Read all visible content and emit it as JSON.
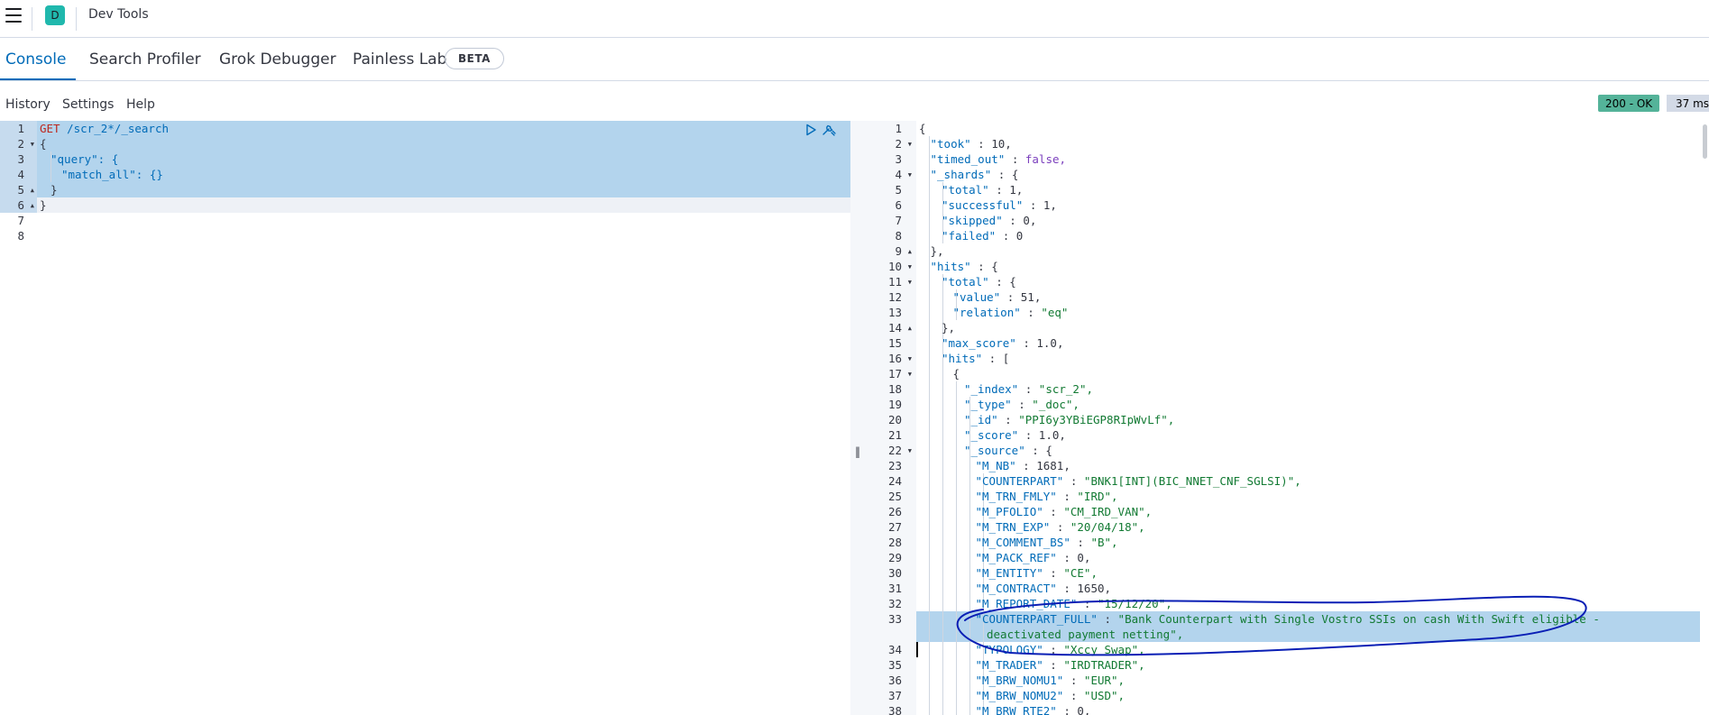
{
  "header": {
    "space_initial": "D",
    "app_title": "Dev Tools"
  },
  "tabs": [
    {
      "label": "Console",
      "active": true
    },
    {
      "label": "Search Profiler",
      "active": false
    },
    {
      "label": "Grok Debugger",
      "active": false
    },
    {
      "label": "Painless Lab",
      "active": false
    }
  ],
  "beta_badge": "BETA",
  "toolbar": {
    "history": "History",
    "settings": "Settings",
    "help": "Help"
  },
  "status": {
    "code": "200 - OK",
    "time": "37 ms",
    "ok_color": "#54b399"
  },
  "request": {
    "line_numbers": [
      "1",
      "2",
      "3",
      "4",
      "5",
      "6",
      "7",
      "8"
    ],
    "method": "GET",
    "path": "/scr_2*/_search",
    "lines": [
      "{",
      "\"query\": {",
      "\"match_all\": {}",
      "}",
      "}",
      "",
      ""
    ]
  },
  "response": {
    "line_numbers": [
      "1",
      "2",
      "3",
      "4",
      "5",
      "6",
      "7",
      "8",
      "9",
      "10",
      "11",
      "12",
      "13",
      "14",
      "15",
      "16",
      "17",
      "18",
      "19",
      "20",
      "21",
      "22",
      "23",
      "24",
      "25",
      "26",
      "27",
      "28",
      "29",
      "30",
      "31",
      "32",
      "33",
      "",
      "34",
      "35",
      "36",
      "37",
      "38"
    ],
    "lines": [
      "{",
      "\"took\" : 10,",
      "\"timed_out\" : false,",
      "\"_shards\" : {",
      "\"total\" : 1,",
      "\"successful\" : 1,",
      "\"skipped\" : 0,",
      "\"failed\" : 0",
      "},",
      "\"hits\" : {",
      "\"total\" : {",
      "\"value\" : 51,",
      "\"relation\" : \"eq\"",
      "},",
      "\"max_score\" : 1.0,",
      "\"hits\" : [",
      "{",
      "\"_index\" : \"scr_2\",",
      "\"_type\" : \"_doc\",",
      "\"_id\" : \"PPI6y3YBiEGP8RIpWvLf\",",
      "\"_score\" : 1.0,",
      "\"_source\" : {",
      "\"M_NB\" : 1681,",
      "\"COUNTERPART\" : \"BNK1[INT](BIC_NNET_CNF_SGLSI)\",",
      "\"M_TRN_FMLY\" : \"IRD\",",
      "\"M_PFOLIO\" : \"CM_IRD_VAN\",",
      "\"M_TRN_EXP\" : \"20/04/18\",",
      "\"M_COMMENT_BS\" : \"B\",",
      "\"M_PACK_REF\" : 0,",
      "\"M_ENTITY\" : \"CE\",",
      "\"M_CONTRACT\" : 1650,",
      "\"M_REPORT_DATE\" : \"15/12/20\",",
      "\"COUNTERPART_FULL\" : \"Bank Counterpart with Single Vostro SSIs on cash With Swift eligible -",
      "deactivated payment netting\",",
      "\"TYPOLOGY\" : \"Xccy Swap\",",
      "\"M_TRADER\" : \"IRDTRADER\",",
      "\"M_BRW_NOMU1\" : \"EUR\",",
      "\"M_BRW_NOMU2\" : \"USD\",",
      "\"M_BRW_RTE2\" : 0,"
    ]
  },
  "icons": {
    "menu": "hamburger-icon",
    "run": "play-icon",
    "settings": "wrench-icon"
  },
  "colors": {
    "accent": "#006bb8",
    "selection": "#b3d4ed",
    "annotation": "#0a1fb5"
  }
}
